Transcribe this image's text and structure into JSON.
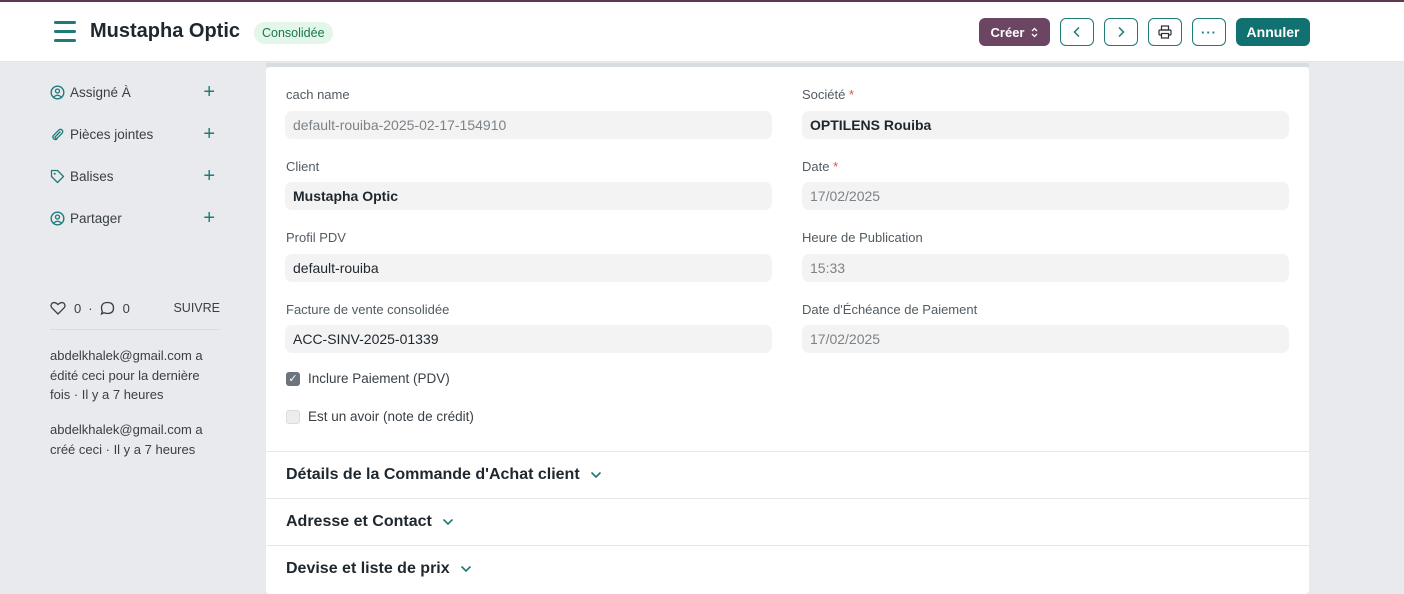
{
  "header": {
    "title": "Mustapha Optic",
    "status_badge": "Consolidée",
    "create_label": "Créer",
    "cancel_label": "Annuler",
    "more_label": "···"
  },
  "sidebar": {
    "items": [
      {
        "label": "Assigné À",
        "icon": "assign-icon"
      },
      {
        "label": "Pièces jointes",
        "icon": "paperclip-icon"
      },
      {
        "label": "Balises",
        "icon": "tag-icon"
      },
      {
        "label": "Partager",
        "icon": "share-icon"
      }
    ],
    "likes_count": "0",
    "comments_count": "0",
    "separator": "·",
    "follow_label": "SUIVRE",
    "activity": [
      "abdelkhalek@gmail.com a édité ceci pour la dernière fois · Il y a 7 heures",
      "abdelkhalek@gmail.com a créé ceci · Il y a 7 heures"
    ]
  },
  "form": {
    "cach_name": {
      "label": "cach name",
      "value": "default-rouiba-2025-02-17-154910"
    },
    "societe": {
      "label": "Société",
      "required": "*",
      "value": "OPTILENS Rouiba"
    },
    "client": {
      "label": "Client",
      "value": "Mustapha Optic"
    },
    "date": {
      "label": "Date",
      "required": "*",
      "value": "17/02/2025"
    },
    "profil_pdv": {
      "label": "Profil PDV",
      "value": "default-rouiba"
    },
    "heure_publication": {
      "label": "Heure de Publication",
      "value": "15:33"
    },
    "facture_consolidee": {
      "label": "Facture de vente consolidée",
      "value": "ACC-SINV-2025-01339"
    },
    "date_echeance": {
      "label": "Date d'Échéance de Paiement",
      "value": "17/02/2025"
    },
    "inclure_paiement": {
      "label": "Inclure Paiement (PDV)",
      "checked": true
    },
    "est_avoir": {
      "label": "Est un avoir (note de crédit)",
      "checked": false
    }
  },
  "sections": [
    {
      "label": "Détails de la Commande d'Achat client"
    },
    {
      "label": "Adresse et Contact"
    },
    {
      "label": "Devise et liste de prix"
    }
  ],
  "colors": {
    "accent": "#1f7a7a",
    "create_button": "#6b4562",
    "cancel_button": "#117070",
    "badge_bg": "#e4f5e9",
    "badge_text": "#16794c"
  }
}
